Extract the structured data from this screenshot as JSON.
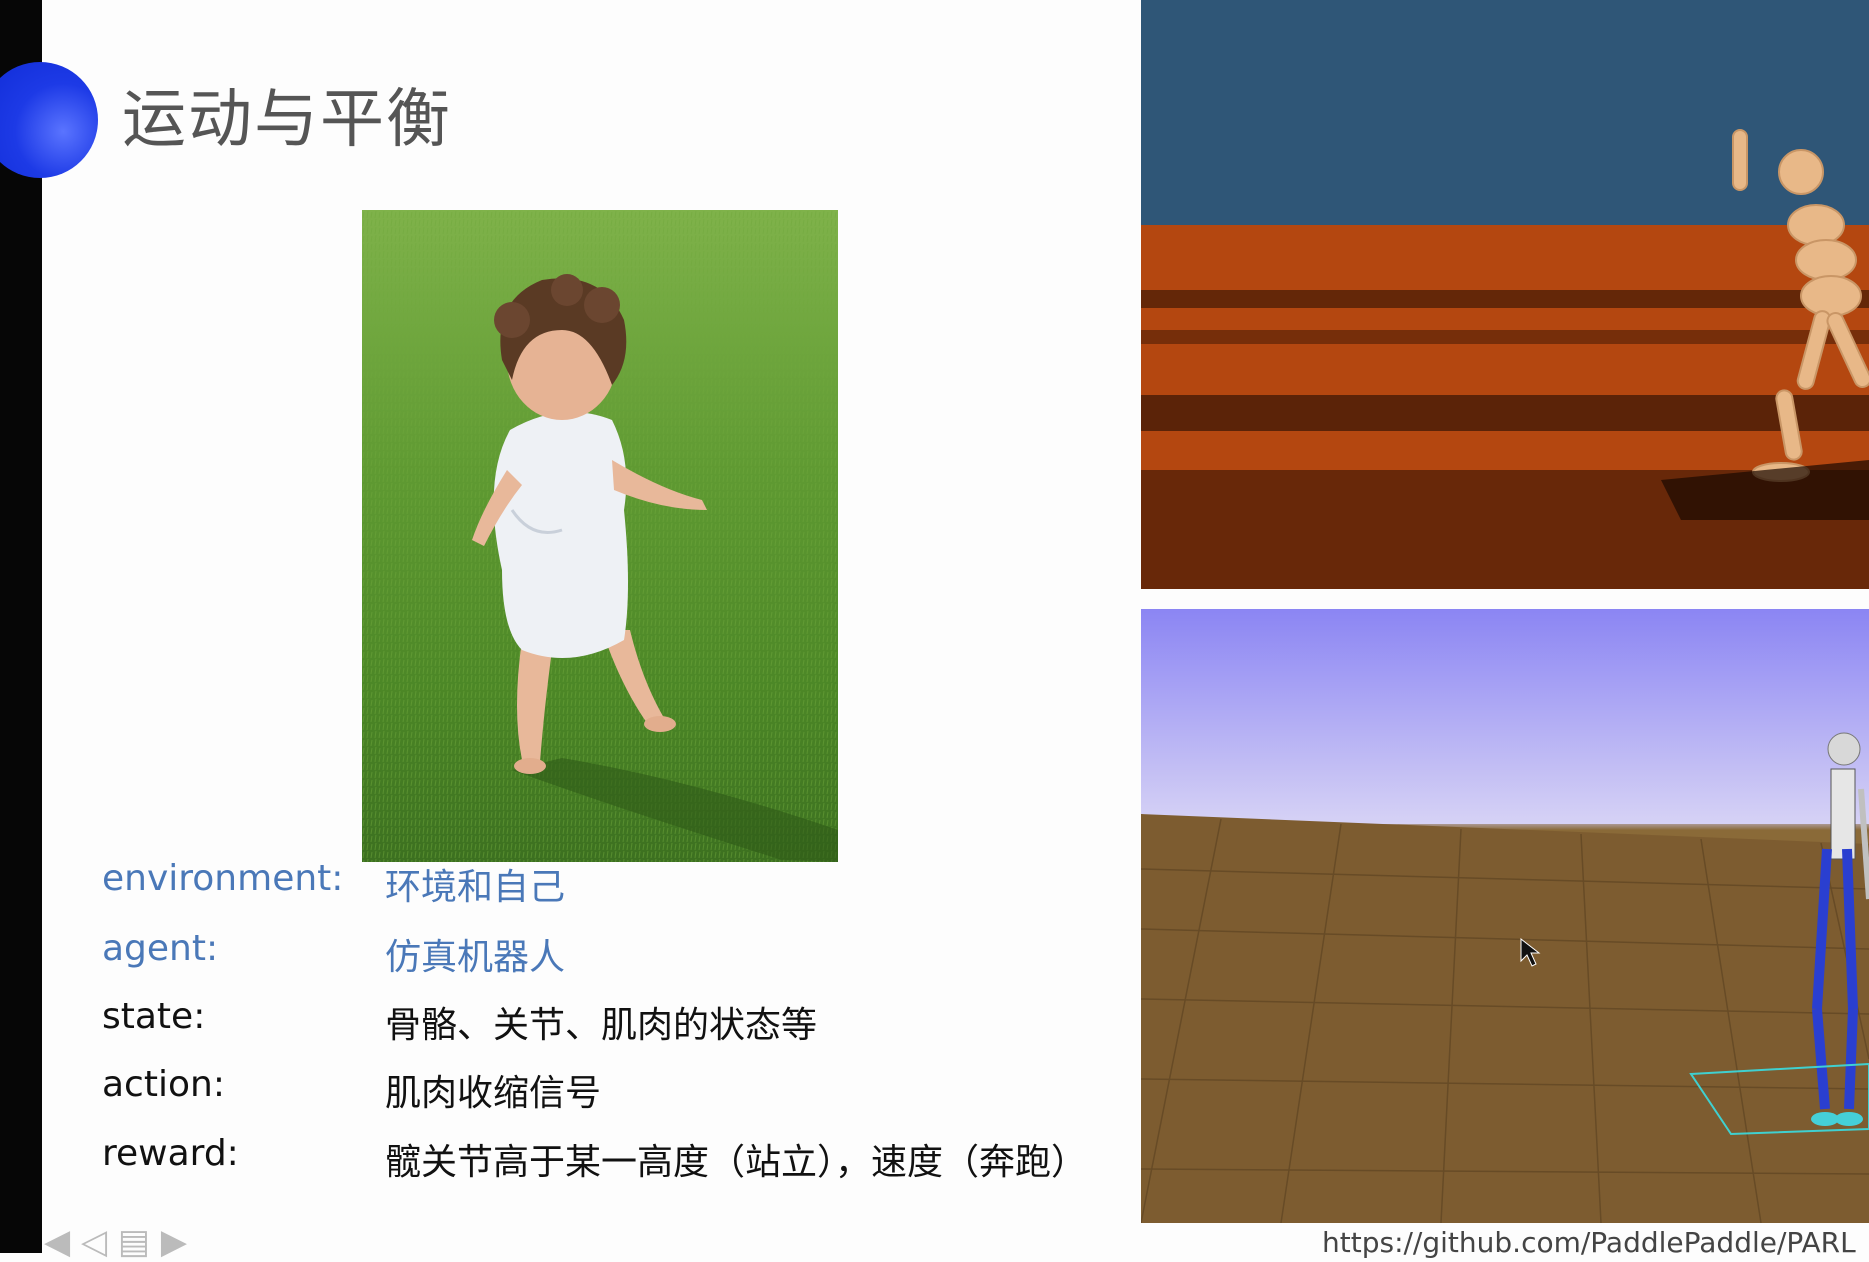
{
  "slide": {
    "title": "运动与平衡"
  },
  "terms": [
    {
      "term": "environment:",
      "definition": "环境和自己",
      "color": "#4a78b8"
    },
    {
      "term": "agent:",
      "definition": "仿真机器人",
      "color": "#4a78b8"
    },
    {
      "term": "state:",
      "definition": "骨骼、关节、肌肉的状态等",
      "color": "#111111"
    },
    {
      "term": "action:",
      "definition": "肌肉收缩信号",
      "color": "#111111"
    },
    {
      "term": "reward:",
      "definition": "髋关节高于某一高度（站立），速度（奔跑）",
      "color": "#111111"
    }
  ],
  "source": {
    "url": "https://github.com/PaddlePaddle/PARL"
  },
  "nav": {
    "label": "◀ ◁ ▤ ▶"
  },
  "colors": {
    "accent": "#1d3ae6",
    "term_blue": "#4a78b8"
  }
}
